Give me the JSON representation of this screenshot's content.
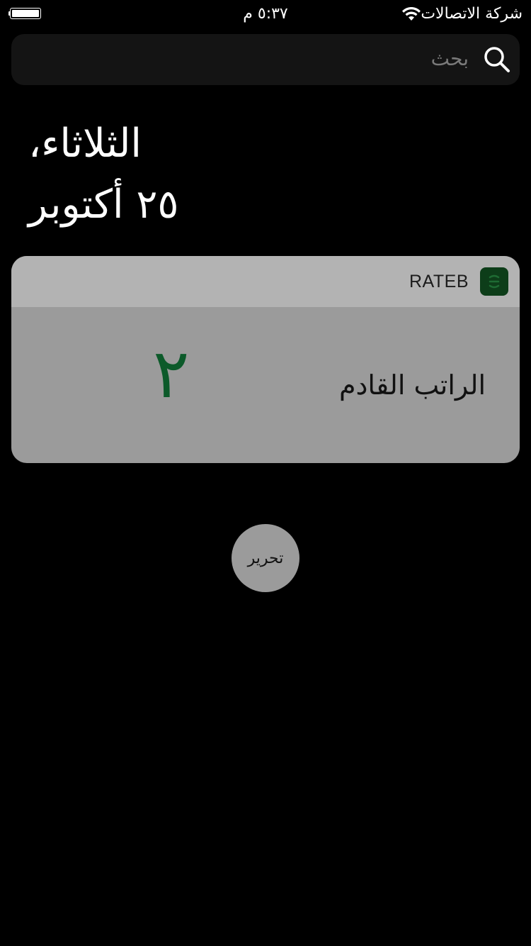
{
  "status_bar": {
    "carrier": "شركة الاتصالات",
    "time": "٥:٣٧ م",
    "battery_level": 1.0,
    "wifi_icon": "wifi-icon",
    "battery_icon": "battery-icon"
  },
  "search": {
    "placeholder": "بحث",
    "icon": "search-icon"
  },
  "date": {
    "weekday": "الثلاثاء،",
    "day_month": "٢٥ أكتوبر"
  },
  "widget": {
    "app_name": "RATEB",
    "app_icon": "rateb-app-icon",
    "app_icon_color": "#0d3d19",
    "label": "الراتب القادم",
    "value": "٢",
    "value_color": "#0c5a2a"
  },
  "edit_button": {
    "label": "تحرير"
  }
}
